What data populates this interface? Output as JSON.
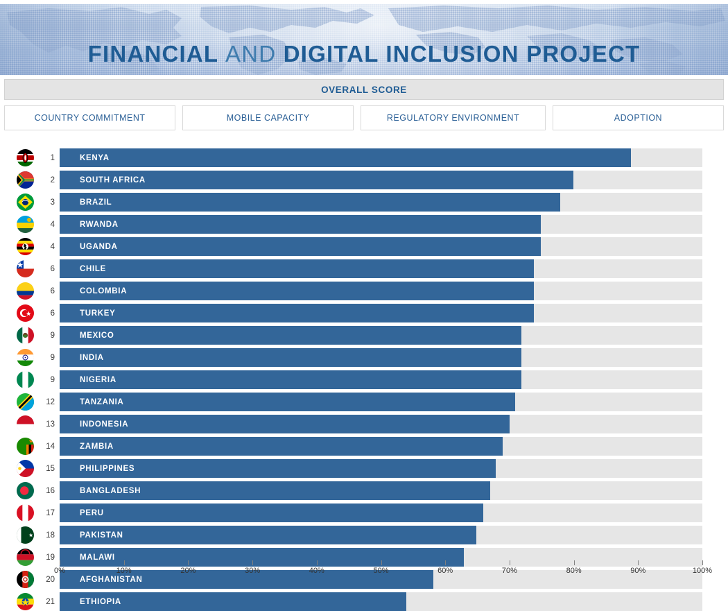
{
  "header": {
    "title_part1": "FINANCIAL ",
    "title_part2": "AND ",
    "title_part3": "DIGITAL INCLUSION  PROJECT",
    "overall_label": "OVERALL SCORE"
  },
  "tabs": [
    {
      "label": "COUNTRY COMMITMENT"
    },
    {
      "label": "MOBILE CAPACITY"
    },
    {
      "label": "REGULATORY ENVIRONMENT"
    },
    {
      "label": "ADOPTION"
    }
  ],
  "colors": {
    "bar": "#336699",
    "track": "#e6e6e6",
    "accent": "#1f5c94",
    "tab_text": "#2a5f96"
  },
  "chart_data": {
    "type": "bar",
    "orientation": "horizontal",
    "title": "OVERALL SCORE",
    "xlabel": "",
    "ylabel": "",
    "xlim": [
      0,
      100
    ],
    "grid": false,
    "legend": "none",
    "tick_labels": [
      "0%",
      "10%",
      "20%",
      "30%",
      "40%",
      "50%",
      "60%",
      "70%",
      "80%",
      "90%",
      "100%"
    ],
    "tick_values": [
      0,
      10,
      20,
      30,
      40,
      50,
      60,
      70,
      80,
      90,
      100
    ],
    "categories": [
      "KENYA",
      "SOUTH AFRICA",
      "BRAZIL",
      "RWANDA",
      "UGANDA",
      "CHILE",
      "COLOMBIA",
      "TURKEY",
      "MEXICO",
      "INDIA",
      "NIGERIA",
      "TANZANIA",
      "INDONESIA",
      "ZAMBIA",
      "PHILIPPINES",
      "BANGLADESH",
      "PERU",
      "PAKISTAN",
      "MALAWI",
      "AFGHANISTAN",
      "ETHIOPIA"
    ],
    "values": [
      88.9,
      79.9,
      77.9,
      74.9,
      74.9,
      73.8,
      73.8,
      73.8,
      71.8,
      71.8,
      71.8,
      70.9,
      70.0,
      68.9,
      67.9,
      67.0,
      65.9,
      64.8,
      62.9,
      58.1,
      53.9
    ],
    "ranks": [
      1,
      2,
      3,
      4,
      4,
      6,
      6,
      6,
      9,
      9,
      9,
      12,
      13,
      14,
      15,
      16,
      17,
      18,
      19,
      20,
      21
    ],
    "rows": [
      {
        "rank": "1",
        "country": "KENYA",
        "value": 88.9,
        "flag": "kenya-flag-icon"
      },
      {
        "rank": "2",
        "country": "SOUTH AFRICA",
        "value": 79.9,
        "flag": "south-africa-flag-icon"
      },
      {
        "rank": "3",
        "country": "BRAZIL",
        "value": 77.9,
        "flag": "brazil-flag-icon"
      },
      {
        "rank": "4",
        "country": "RWANDA",
        "value": 74.9,
        "flag": "rwanda-flag-icon"
      },
      {
        "rank": "4",
        "country": "UGANDA",
        "value": 74.9,
        "flag": "uganda-flag-icon"
      },
      {
        "rank": "6",
        "country": "CHILE",
        "value": 73.8,
        "flag": "chile-flag-icon"
      },
      {
        "rank": "6",
        "country": "COLOMBIA",
        "value": 73.8,
        "flag": "colombia-flag-icon"
      },
      {
        "rank": "6",
        "country": "TURKEY",
        "value": 73.8,
        "flag": "turkey-flag-icon"
      },
      {
        "rank": "9",
        "country": "MEXICO",
        "value": 71.8,
        "flag": "mexico-flag-icon"
      },
      {
        "rank": "9",
        "country": "INDIA",
        "value": 71.8,
        "flag": "india-flag-icon"
      },
      {
        "rank": "9",
        "country": "NIGERIA",
        "value": 71.8,
        "flag": "nigeria-flag-icon"
      },
      {
        "rank": "12",
        "country": "TANZANIA",
        "value": 70.9,
        "flag": "tanzania-flag-icon"
      },
      {
        "rank": "13",
        "country": "INDONESIA",
        "value": 70.0,
        "flag": "indonesia-flag-icon"
      },
      {
        "rank": "14",
        "country": "ZAMBIA",
        "value": 68.9,
        "flag": "zambia-flag-icon"
      },
      {
        "rank": "15",
        "country": "PHILIPPINES",
        "value": 67.9,
        "flag": "philippines-flag-icon"
      },
      {
        "rank": "16",
        "country": "BANGLADESH",
        "value": 67.0,
        "flag": "bangladesh-flag-icon"
      },
      {
        "rank": "17",
        "country": "PERU",
        "value": 65.9,
        "flag": "peru-flag-icon"
      },
      {
        "rank": "18",
        "country": "PAKISTAN",
        "value": 64.8,
        "flag": "pakistan-flag-icon"
      },
      {
        "rank": "19",
        "country": "MALAWI",
        "value": 62.9,
        "flag": "malawi-flag-icon"
      },
      {
        "rank": "20",
        "country": "AFGHANISTAN",
        "value": 58.1,
        "flag": "afghanistan-flag-icon"
      },
      {
        "rank": "21",
        "country": "ETHIOPIA",
        "value": 53.9,
        "flag": "ethiopia-flag-icon"
      }
    ]
  }
}
